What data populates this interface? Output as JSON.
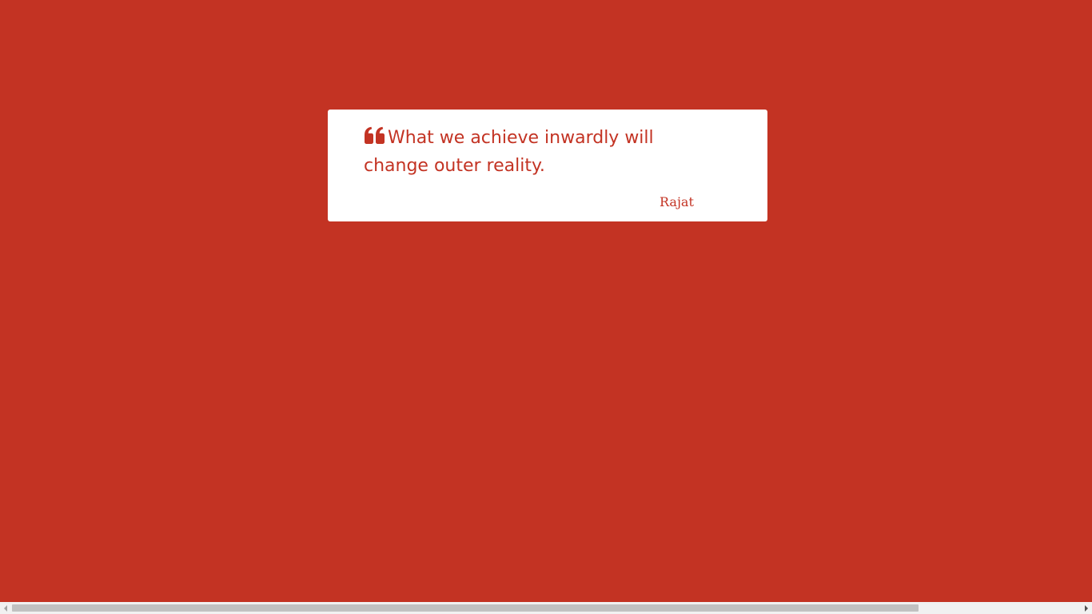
{
  "quote": {
    "icon": "quote-left-icon",
    "text": "What we achieve inwardly will change outer reality.",
    "author": "Rajat"
  },
  "colors": {
    "background": "#c33323",
    "card": "#ffffff",
    "accent": "#c33323"
  },
  "scrollbar": {
    "horizontal_thumb_fraction": 0.83
  }
}
